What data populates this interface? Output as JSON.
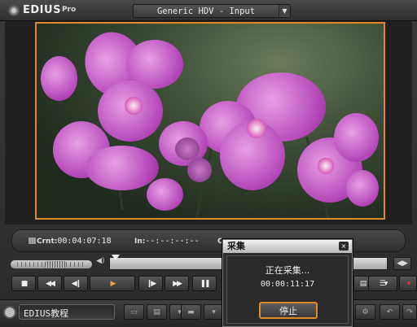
{
  "app": {
    "logo_text": "EDIUS",
    "logo_suffix": "Pro",
    "preset": "Generic HDV - Input"
  },
  "timecode": {
    "crnt_label": "Crnt:",
    "crnt_value": "00:04:07:18",
    "in_label": "In:",
    "in_value": "--:--:--:--",
    "out_label": "Ou"
  },
  "transport": {
    "buttons": [
      "stop",
      "rewind",
      "step-back",
      "play",
      "step-forward",
      "fast-forward",
      "pause",
      "record"
    ]
  },
  "project": {
    "name": "EDIUS教程"
  },
  "dialog": {
    "title": "采集",
    "close": "×",
    "status": "正在采集...",
    "elapsed": "00:00:11:17",
    "stop_label": "停止"
  },
  "colors": {
    "accent": "#e08a2a",
    "panel": "#2b2b2b"
  }
}
